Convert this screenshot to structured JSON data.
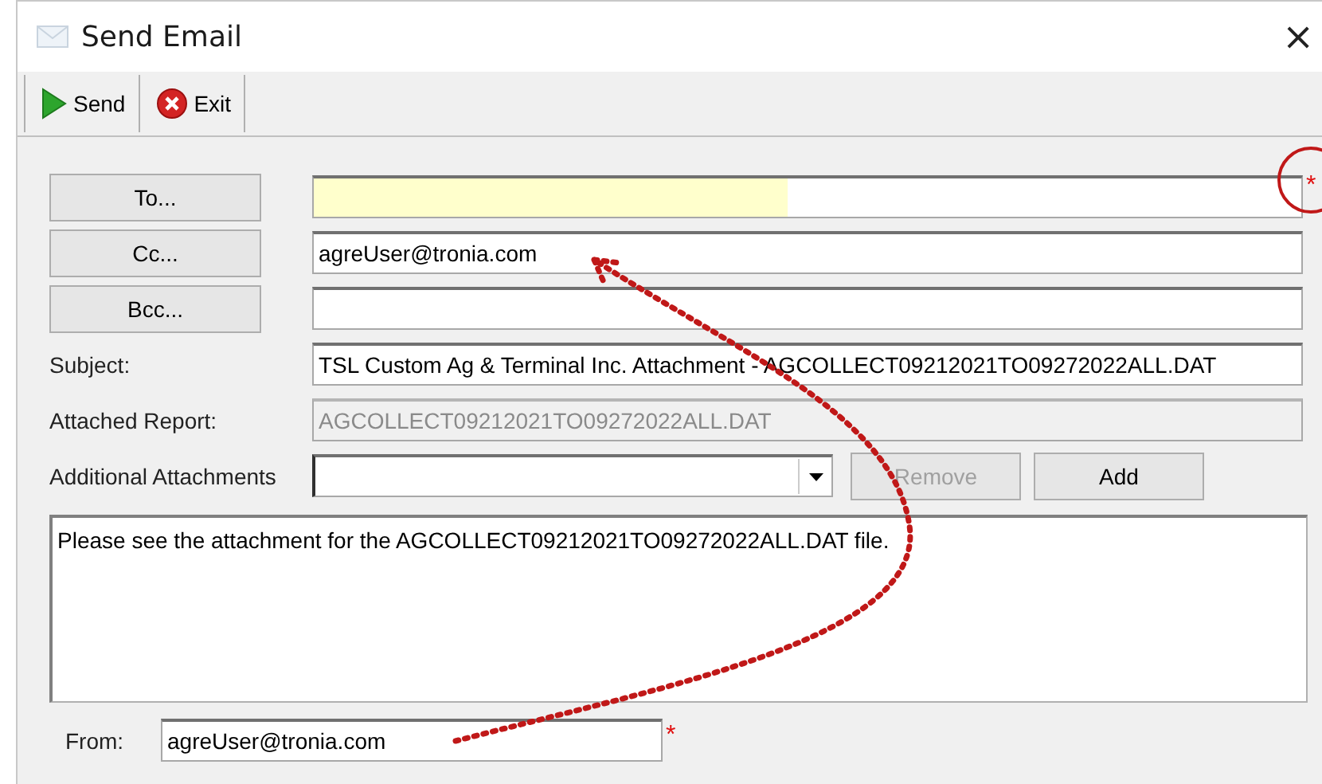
{
  "window": {
    "title": "Send Email",
    "close": "×"
  },
  "toolbar": [
    {
      "kind": "send",
      "label": "Send"
    },
    {
      "kind": "exit",
      "label": "Exit"
    }
  ],
  "recipients": [
    {
      "button": "To...",
      "required": true,
      "highlighted": true
    },
    {
      "button": "Cc...",
      "value": "agreUser@tronia.com",
      "required": false,
      "highlighted": false
    },
    {
      "button": "Bcc...",
      "required": false,
      "highlighted": false
    }
  ],
  "subject": {
    "label": "Subject:",
    "value": "TSL Custom Ag & Terminal Inc. Attachment - AGCOLLECT09212021TO09272022ALL.DAT"
  },
  "attached_report": {
    "label": "Attached Report:",
    "value": "AGCOLLECT09212021TO09272022ALL.DAT",
    "disabled": true
  },
  "additional_attachments": {
    "label": "Additional Attachments",
    "buttons": [
      {
        "label": "Remove",
        "disabled": true
      },
      {
        "label": "Add",
        "disabled": false
      }
    ]
  },
  "body": "Please see the attachment for the AGCOLLECT09212021TO09272022ALL.DAT file.",
  "from": {
    "label": "From:",
    "value": "agreUser@tronia.com",
    "required": true
  },
  "required_mark": "*"
}
